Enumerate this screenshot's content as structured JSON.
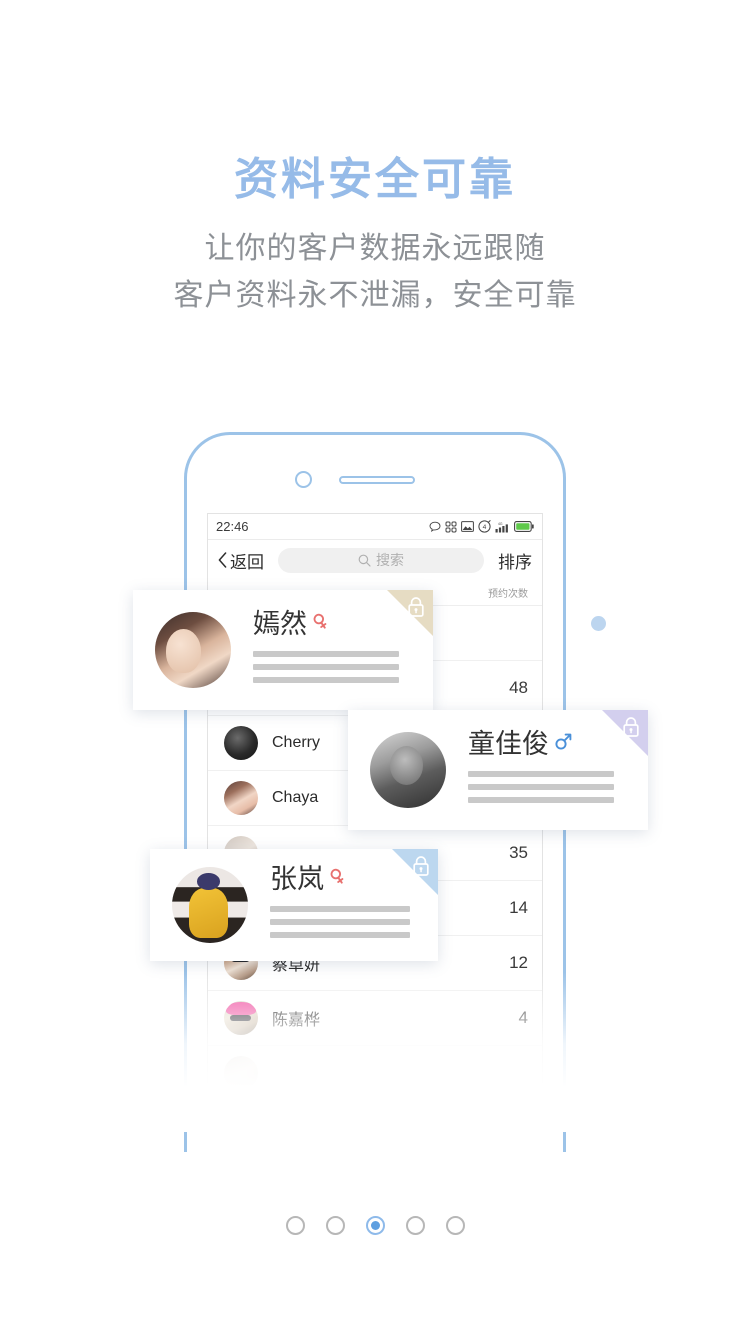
{
  "hero": {
    "title": "资料安全可靠",
    "subtitle_line1": "让你的客户数据永远跟随",
    "subtitle_line2": "客户资料永不泄漏，安全可靠"
  },
  "phone": {
    "status_bar": {
      "time": "22:46",
      "icons": [
        "message-bubble-icon",
        "qr-grid-icon",
        "photo-icon",
        "4g-network-icon",
        "signal-bars-icon",
        "battery-icon"
      ],
      "battery_color": "#5ec94a"
    },
    "nav_bar": {
      "back_label": "返回",
      "search_placeholder": "搜索",
      "sort_label": "排序"
    },
    "list": {
      "column_header": "预约次数",
      "rows": [
        {
          "name": "",
          "count": "",
          "avatar": "ph-hidden1"
        },
        {
          "name": "",
          "count": "48",
          "avatar": "ph-partial"
        },
        {
          "name": "Cherry",
          "count": "",
          "avatar": "ph-cherry"
        },
        {
          "name": "Chaya",
          "count": "",
          "avatar": "ph-chaya"
        },
        {
          "name": "",
          "count": "35",
          "avatar": "ph-partial"
        },
        {
          "name": "",
          "count": "14",
          "avatar": "ph-partial"
        },
        {
          "name": "蔡卓妍",
          "count": "12",
          "avatar": "ph-cai"
        },
        {
          "name": "陈嘉桦",
          "count": "4",
          "avatar": "ph-chen"
        }
      ]
    }
  },
  "cards": [
    {
      "name": "嫣然",
      "gender": "female",
      "gender_icon": "female-symbol-icon",
      "gender_color": "#e8706e",
      "corner_color": "#e6dcc3",
      "lock_icon": "lock-icon",
      "avatar": "ph-yanran"
    },
    {
      "name": "童佳俊",
      "gender": "male",
      "gender_icon": "male-symbol-icon",
      "gender_color": "#4a90d9",
      "corner_color": "#d3cfee",
      "lock_icon": "lock-icon",
      "avatar": "ph-tong"
    },
    {
      "name": "张岚",
      "gender": "female",
      "gender_icon": "female-symbol-icon",
      "gender_color": "#e8706e",
      "corner_color": "#bcd7ef",
      "lock_icon": "lock-icon",
      "avatar": "ph-zhang"
    }
  ],
  "pagination": {
    "total": 5,
    "active_index": 2
  },
  "theme": {
    "accent": "#96bbe8",
    "phone_frame": "#9cc3e8",
    "subtitle_color": "#8d9196",
    "decorative_dot": "#bcd5ef"
  }
}
